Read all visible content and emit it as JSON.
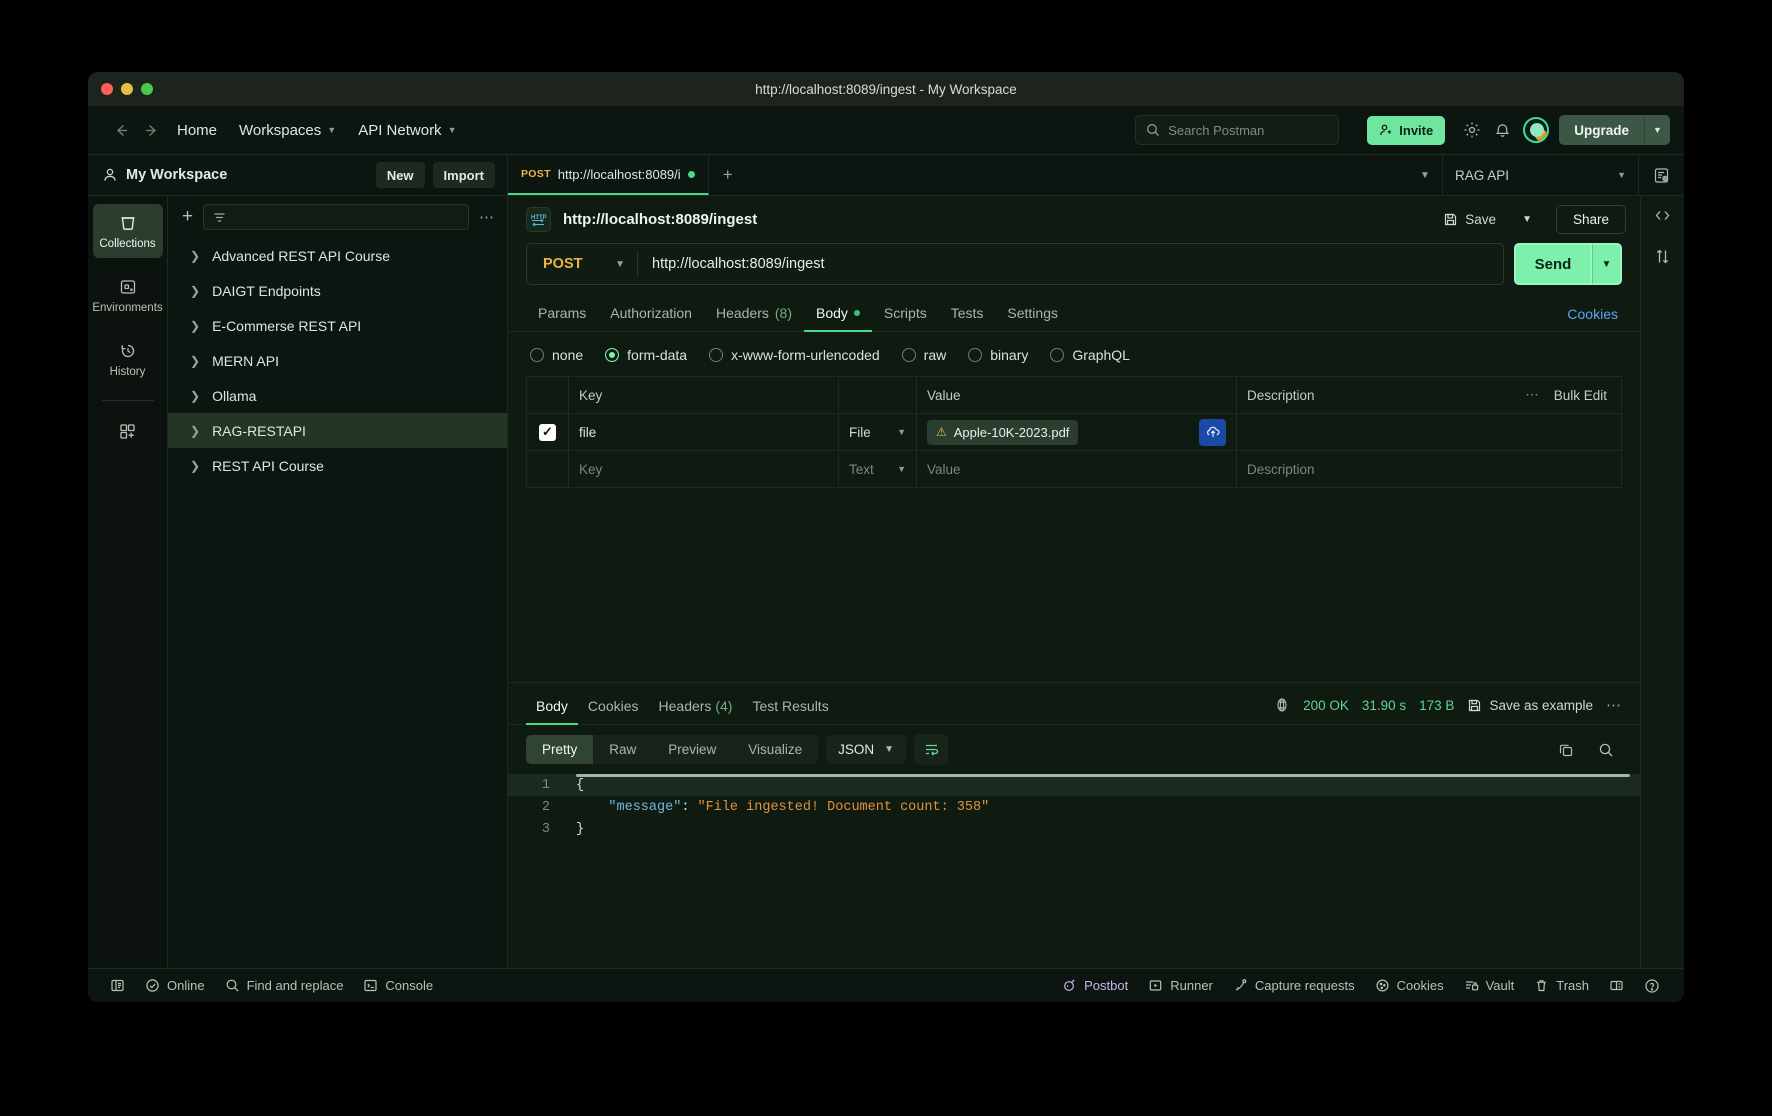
{
  "window": {
    "title": "http://localhost:8089/ingest - My Workspace"
  },
  "topnav": {
    "back_icon": "arrow-left-icon",
    "forward_icon": "arrow-right-icon",
    "home": "Home",
    "workspaces": "Workspaces",
    "api_network": "API Network",
    "search_placeholder": "Search Postman",
    "invite": "Invite",
    "upgrade": "Upgrade"
  },
  "workspace": {
    "name": "My Workspace",
    "new_label": "New",
    "import_label": "Import",
    "environment": "RAG API"
  },
  "rail": {
    "items": [
      {
        "label": "Collections",
        "icon": "collections-icon",
        "active": true
      },
      {
        "label": "Environments",
        "icon": "environments-icon",
        "active": false
      },
      {
        "label": "History",
        "icon": "history-icon",
        "active": false
      }
    ],
    "add_label": "add-apps-icon"
  },
  "sidebar": {
    "filter_placeholder": "",
    "collections": [
      {
        "name": "Advanced REST API Course",
        "selected": false
      },
      {
        "name": "DAIGT Endpoints",
        "selected": false
      },
      {
        "name": "E-Commerse REST API",
        "selected": false
      },
      {
        "name": "MERN API",
        "selected": false
      },
      {
        "name": "Ollama",
        "selected": false
      },
      {
        "name": "RAG-RESTAPI",
        "selected": true
      },
      {
        "name": "REST API Course",
        "selected": false
      }
    ]
  },
  "request_tab": {
    "method": "POST",
    "title": "http://localhost:8089/i",
    "unsaved": true
  },
  "request": {
    "protocol_badge": "HTTP",
    "title": "http://localhost:8089/ingest",
    "save_label": "Save",
    "share_label": "Share",
    "method": "POST",
    "url": "http://localhost:8089/ingest",
    "send_label": "Send",
    "tabs": [
      {
        "label": "Params",
        "active": false
      },
      {
        "label": "Authorization",
        "active": false
      },
      {
        "label": "Headers",
        "count": "(8)",
        "active": false
      },
      {
        "label": "Body",
        "active": true,
        "dot": true
      },
      {
        "label": "Scripts",
        "active": false
      },
      {
        "label": "Tests",
        "active": false
      },
      {
        "label": "Settings",
        "active": false
      }
    ],
    "cookies_link": "Cookies",
    "body_types": [
      {
        "label": "none",
        "selected": false
      },
      {
        "label": "form-data",
        "selected": true
      },
      {
        "label": "x-www-form-urlencoded",
        "selected": false
      },
      {
        "label": "raw",
        "selected": false
      },
      {
        "label": "binary",
        "selected": false
      },
      {
        "label": "GraphQL",
        "selected": false
      }
    ],
    "table": {
      "headers": {
        "key": "Key",
        "value": "Value",
        "description": "Description",
        "bulk_edit": "Bulk Edit"
      },
      "rows": [
        {
          "checked": true,
          "key": "file",
          "type": "File",
          "value": "Apple-10K-2023.pdf",
          "value_warning": true,
          "description": "",
          "upload_icon": "cloud-upload-icon"
        }
      ],
      "empty_row": {
        "key_placeholder": "Key",
        "type": "Text",
        "value_placeholder": "Value",
        "description_placeholder": "Description"
      }
    }
  },
  "response": {
    "tabs": [
      {
        "label": "Body",
        "active": true
      },
      {
        "label": "Cookies",
        "active": false
      },
      {
        "label": "Headers",
        "count": "(4)",
        "active": false
      },
      {
        "label": "Test Results",
        "active": false
      }
    ],
    "status": "200 OK",
    "time": "31.90 s",
    "size": "173 B",
    "save_example": "Save as example",
    "formats": [
      {
        "label": "Pretty",
        "active": true
      },
      {
        "label": "Raw",
        "active": false
      },
      {
        "label": "Preview",
        "active": false
      },
      {
        "label": "Visualize",
        "active": false
      }
    ],
    "language": "JSON",
    "body_lines": [
      {
        "n": "1",
        "text": "{",
        "type": "punct"
      },
      {
        "n": "2",
        "key": "\"message\"",
        "sep": ": ",
        "value": "\"File ingested! Document count: 358\"",
        "type": "kv",
        "indent": "    "
      },
      {
        "n": "3",
        "text": "}",
        "type": "punct"
      }
    ]
  },
  "statusbar": {
    "left": [
      {
        "label": "",
        "icon": "sidebar-toggle-icon"
      },
      {
        "label": "Online",
        "icon": "online-check-icon"
      },
      {
        "label": "Find and replace",
        "icon": "search-icon"
      },
      {
        "label": "Console",
        "icon": "console-icon"
      }
    ],
    "right": [
      {
        "label": "Postbot",
        "icon": "postbot-icon"
      },
      {
        "label": "Runner",
        "icon": "runner-icon"
      },
      {
        "label": "Capture requests",
        "icon": "capture-icon"
      },
      {
        "label": "Cookies",
        "icon": "cookie-icon"
      },
      {
        "label": "Vault",
        "icon": "vault-icon"
      },
      {
        "label": "Trash",
        "icon": "trash-icon"
      },
      {
        "label": "",
        "icon": "layout-icon"
      },
      {
        "label": "",
        "icon": "help-icon"
      }
    ]
  },
  "colors": {
    "accent_green": "#7df0ab",
    "method_orange": "#e8b547",
    "status_green": "#5fd694",
    "link_blue": "#5aa7f0",
    "upload_blue": "#1a49a8"
  }
}
